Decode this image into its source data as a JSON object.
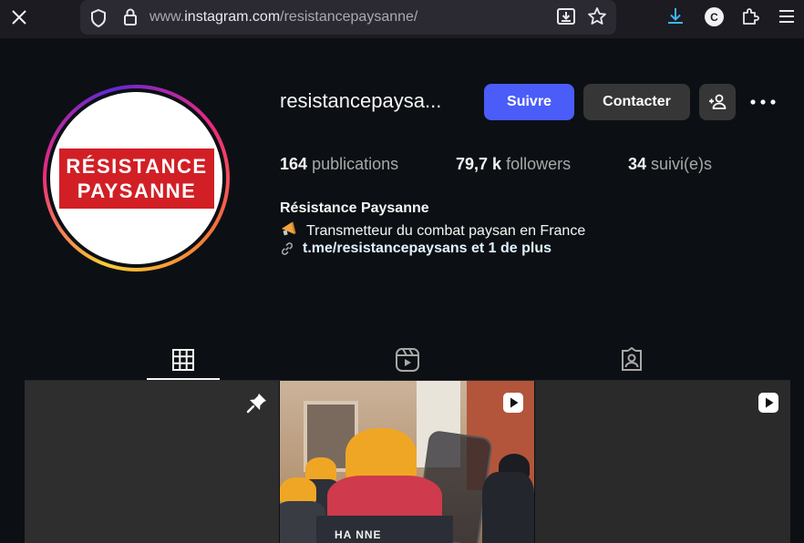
{
  "browser": {
    "url_prefix": "www.",
    "url_domain": "instagram.com",
    "url_path": "/resistancepaysanne/",
    "account_initial": "C"
  },
  "profile": {
    "username": "resistancepaysa...",
    "logo_line1": "RÉSISTANCE",
    "logo_line2": "PAYSANNE",
    "follow_label": "Suivre",
    "contact_label": "Contacter",
    "adduser_label": "+",
    "stats": {
      "posts_count": "164",
      "posts_label": "publications",
      "followers_count": "79,7 k",
      "followers_label": "followers",
      "following_count": "34",
      "following_label": "suivi(e)s"
    },
    "full_name": "Résistance Paysanne",
    "bio": "Transmetteur du combat paysan en France",
    "link": "t.me/resistancepaysans et 1 de plus"
  },
  "tabs": [
    {
      "name": "posts",
      "icon": "grid-icon",
      "active": true
    },
    {
      "name": "reels",
      "icon": "reels-icon",
      "active": false
    },
    {
      "name": "tagged",
      "icon": "tagged-icon",
      "active": false
    }
  ],
  "grid": {
    "cell1_badge": "pin-icon",
    "cell2_badge": "video-icon",
    "cell2_jacket_text": "HA     NNE",
    "cell3_badge": "video-icon"
  },
  "colors": {
    "background": "#0c1014",
    "follow_button": "#4a5df9",
    "secondary_button": "#363636",
    "logo_red": "#d21f26"
  }
}
